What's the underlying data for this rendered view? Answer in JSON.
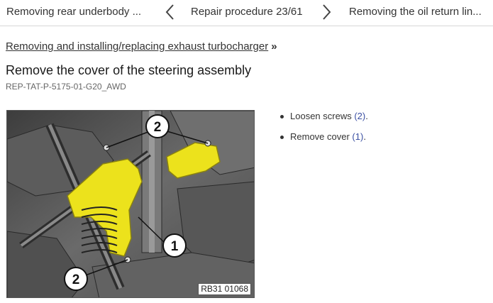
{
  "nav": {
    "prev_title": "Removing rear underbody ...",
    "position": "Repair procedure 23/61",
    "next_title": "Removing the oil return lin..."
  },
  "breadcrumb": {
    "parent_link": "Removing and installing/replacing exhaust turbocharger",
    "separator": "»"
  },
  "page": {
    "title": "Remove the cover of the steering assembly",
    "doc_id": "REP-TAT-P-5175-01-G20_AWD"
  },
  "figure": {
    "caption": "RB31 01068",
    "callouts": [
      "2",
      "1",
      "2"
    ],
    "highlight_color": "#ece21c"
  },
  "steps": [
    {
      "text": "Loosen screws ",
      "ref": "(2)",
      "tail": "."
    },
    {
      "text": "Remove cover ",
      "ref": "(1)",
      "tail": "."
    }
  ]
}
